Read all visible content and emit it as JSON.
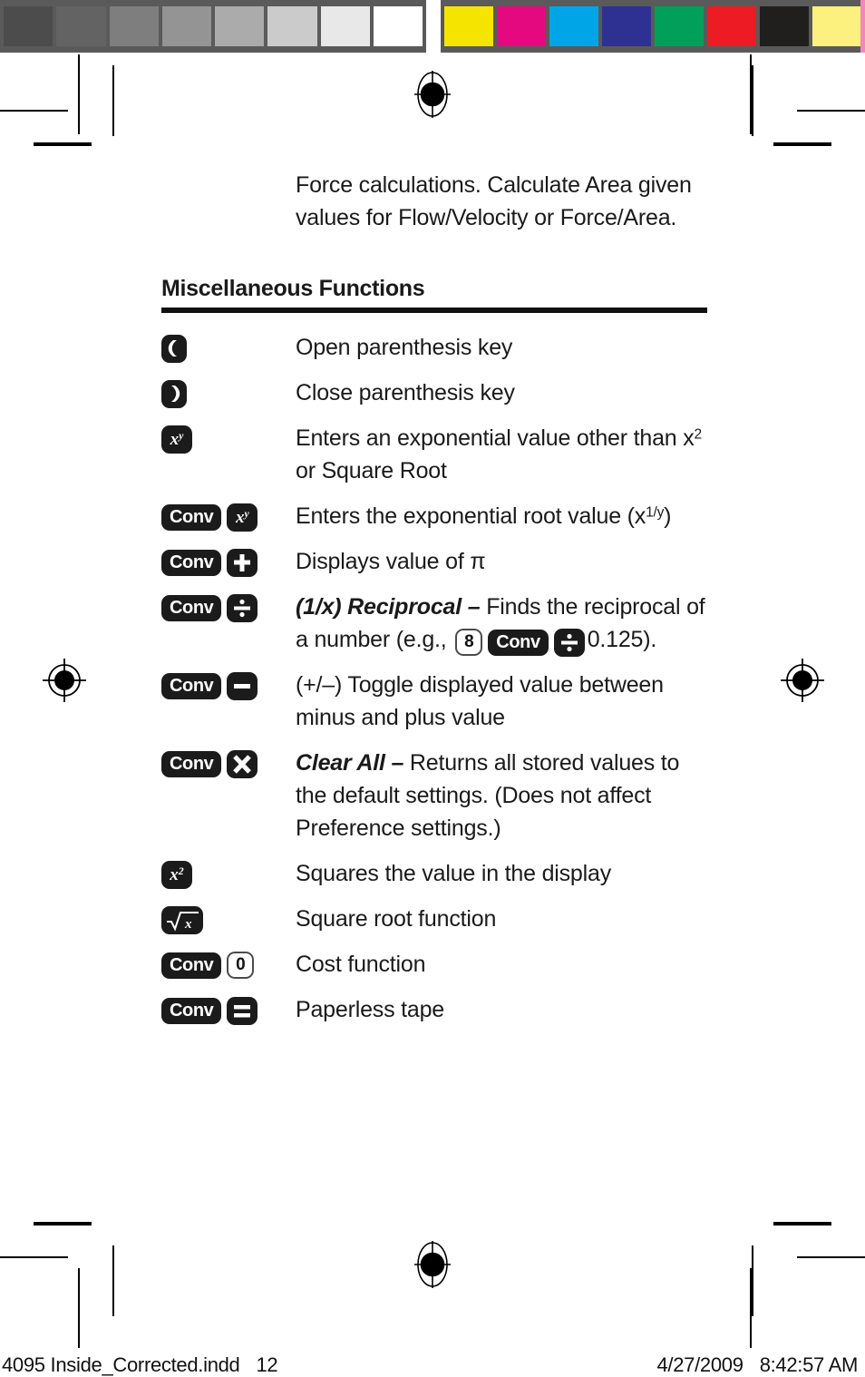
{
  "calibration": {
    "gray_swatches": [
      "#4c4c4c",
      "#636363",
      "#7e7e7e",
      "#949494",
      "#ababab",
      "#cbcbcb",
      "#e8e8e8",
      "#ffffff"
    ],
    "color_swatches": [
      "#f5e400",
      "#e5097f",
      "#00a5e8",
      "#2e3192",
      "#00a05a",
      "#ed1c24",
      "#211e1e",
      "#fcf07f"
    ],
    "edge_color": "#f287bd",
    "bar_background": "#5a5a5a"
  },
  "page": {
    "intro_paragraph": "Force calculations. Calculate Area given values for Flow/Velocity or Force/Area.",
    "section_heading": "Miscellaneous Functions"
  },
  "rows": [
    {
      "keys": [
        {
          "type": "open-paren",
          "label": "("
        }
      ],
      "description": "Open parenthesis key"
    },
    {
      "keys": [
        {
          "type": "close-paren",
          "label": ")"
        }
      ],
      "description": "Close parenthesis key"
    },
    {
      "keys": [
        {
          "type": "power",
          "label": "x",
          "sup": "y"
        }
      ],
      "description_parts": [
        {
          "text": "Enters an exponential value other than x"
        },
        {
          "text": "2",
          "sup": true
        },
        {
          "text": " or Square Root"
        }
      ]
    },
    {
      "keys": [
        {
          "type": "conv",
          "label": "Conv"
        },
        {
          "type": "power",
          "label": "x",
          "sup": "y"
        }
      ],
      "description_parts": [
        {
          "text": "Enters the exponential root value (x"
        },
        {
          "text": "1/y",
          "sup": true
        },
        {
          "text": ")"
        }
      ]
    },
    {
      "keys": [
        {
          "type": "conv",
          "label": "Conv"
        },
        {
          "type": "plus",
          "label": "+"
        }
      ],
      "description_parts": [
        {
          "text": "Displays value of π"
        }
      ]
    },
    {
      "keys": [
        {
          "type": "conv",
          "label": "Conv"
        },
        {
          "type": "divide",
          "label": "÷"
        }
      ],
      "title": "(1/x) Reciprocal",
      "dash": " – ",
      "description_parts": [
        {
          "text": "Finds the reciprocal of a number (e.g., "
        },
        {
          "text": "8",
          "key_light": true
        },
        {
          "text": "Conv",
          "key_conv": true
        },
        {
          "text": "÷",
          "key_divide": true
        },
        {
          "text": "0.125)."
        }
      ]
    },
    {
      "keys": [
        {
          "type": "conv",
          "label": "Conv"
        },
        {
          "type": "minus",
          "label": "–"
        }
      ],
      "description": "(+/–) Toggle displayed value between minus and plus value"
    },
    {
      "keys": [
        {
          "type": "conv",
          "label": "Conv"
        },
        {
          "type": "times",
          "label": "×"
        }
      ],
      "title": "Clear All",
      "dash": " – ",
      "description": "Returns all stored values to the default settings. (Does not affect Preference settings.)"
    },
    {
      "keys": [
        {
          "type": "square",
          "label": "x",
          "sup": "2"
        }
      ],
      "description": "Squares the value in the display"
    },
    {
      "keys": [
        {
          "type": "sqrt",
          "label": "√x"
        }
      ],
      "description": "Square root function"
    },
    {
      "keys": [
        {
          "type": "conv",
          "label": "Conv"
        },
        {
          "type": "zero",
          "label": "0"
        }
      ],
      "description": "Cost function"
    },
    {
      "keys": [
        {
          "type": "conv",
          "label": "Conv"
        },
        {
          "type": "equals",
          "label": "="
        }
      ],
      "description": "Paperless tape"
    }
  ],
  "footer": {
    "file_name": "4095 Inside_Corrected.indd",
    "page_number": "12",
    "date": "4/27/2009",
    "time": "8:42:57 AM"
  }
}
